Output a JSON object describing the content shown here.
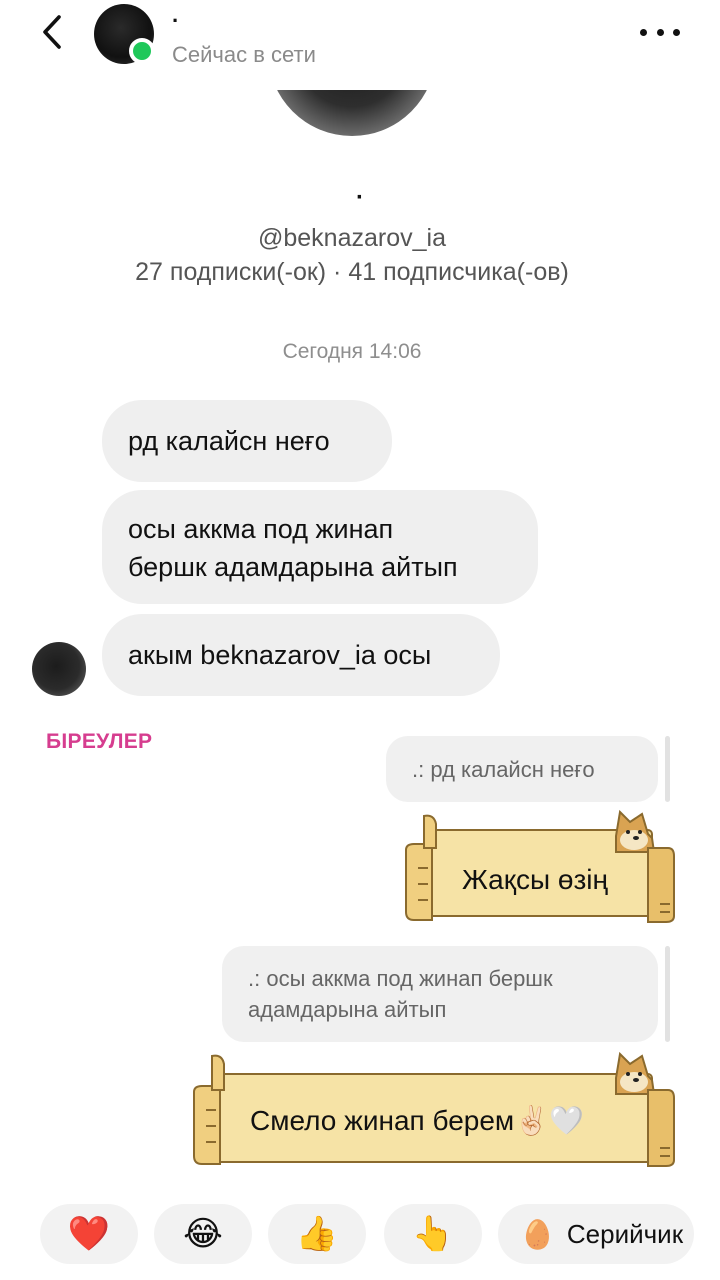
{
  "header": {
    "name": "·",
    "status": "Сейчас в сети"
  },
  "profile": {
    "display_name": "·",
    "handle": "@beknazarov_ia",
    "stats": "27 подписки(-ок) · 41 подписчика(-ов)"
  },
  "chat": {
    "date_separator": "Сегодня 14:06",
    "incoming": [
      {
        "text": "рд калайсн неғо"
      },
      {
        "line1": "осы аккма под жинап",
        "line2": "бершк адамдарына айтып"
      },
      {
        "text": "акым beknazarov_ia осы"
      }
    ],
    "reply_label": "БІРЕУЛЕР",
    "outgoing": [
      {
        "quote": ".: рд калайсн неғо",
        "sticker_text": "Жақсы өзің"
      },
      {
        "quote_line1": ".: осы аккма под жинап бершк",
        "quote_line2": "адамдарына айтып",
        "sticker_text": "Смело жинап берем✌🏻🤍"
      }
    ]
  },
  "quick_reactions": [
    {
      "emoji": "❤️",
      "icon": "heart-icon"
    },
    {
      "emoji": "😂",
      "icon": "laughing-face-icon"
    },
    {
      "emoji": "👍",
      "icon": "thumbs-up-icon"
    },
    {
      "emoji": "👆",
      "icon": "pointing-up-icon"
    },
    {
      "emoji": "🥚",
      "icon": "egg-sticker-icon",
      "label": "Серийчик"
    }
  ],
  "colors": {
    "online": "#1fc85a",
    "accent_label": "#d63d8f",
    "bubble": "#efefef",
    "sign": "#f6e3a6",
    "sign_border": "#b58a3c"
  }
}
